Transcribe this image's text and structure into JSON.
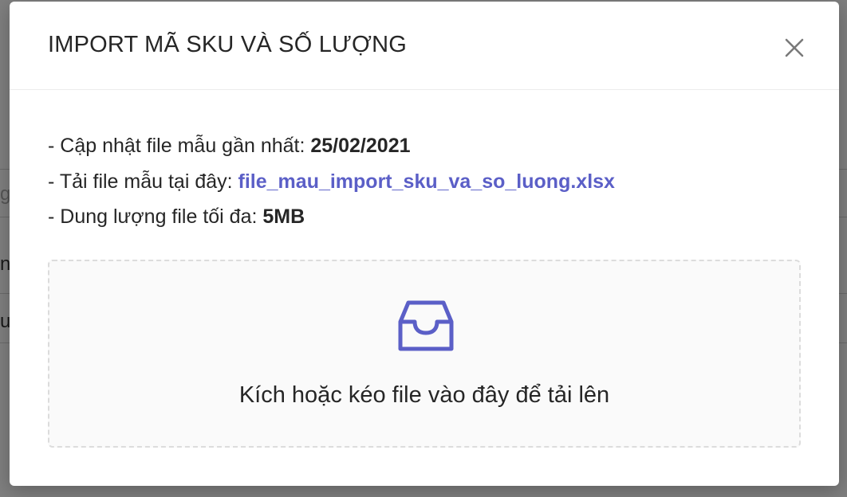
{
  "background": {
    "fragments": [
      "g",
      "nh",
      "u"
    ]
  },
  "dialog": {
    "title": "IMPORT MÃ SKU VÀ SỐ LƯỢNG",
    "close_icon": "close-icon",
    "info": {
      "updated_label": "- Cập nhật file mẫu gần nhất: ",
      "updated_value": "25/02/2021",
      "template_label": "- Tải file mẫu tại đây: ",
      "template_link": "file_mau_import_sku_va_so_luong.xlsx",
      "max_size_label": "- Dung lượng file tối đa: ",
      "max_size_value": "5MB"
    },
    "dropzone": {
      "icon": "inbox-icon",
      "text": "Kích hoặc kéo file vào đây để tải lên"
    },
    "colors": {
      "link": "#5b5fc7",
      "icon": "#5b5fc7",
      "overlay": "rgba(0,0,0,0.5)"
    }
  }
}
